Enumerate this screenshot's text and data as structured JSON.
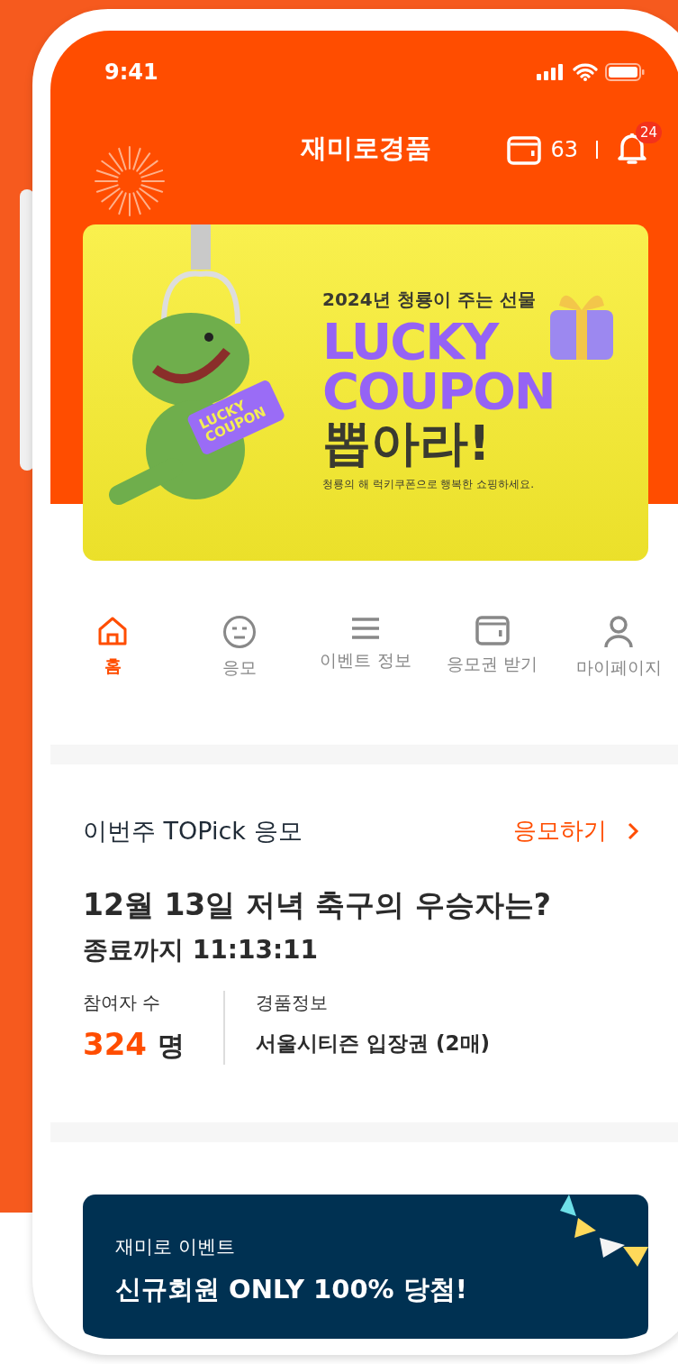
{
  "status_bar": {
    "time": "9:41"
  },
  "header": {
    "title": "재미로경품",
    "wallet_count": "63",
    "notification_badge": "24"
  },
  "banner": {
    "subtitle": "2024년 청룡이 주는 선물",
    "headline": "LUCKY COUPON",
    "title": "뽑아라!",
    "caption": "청룡의 해 럭키쿠폰으로 행복한 쇼핑하세요.",
    "coupon_text": "LUCKY COUPON"
  },
  "nav": [
    {
      "label": "홈",
      "kind": "home",
      "selected": true
    },
    {
      "label": "응모",
      "kind": "face",
      "selected": false
    },
    {
      "label": "이벤트 정보",
      "kind": "list",
      "selected": false
    },
    {
      "label": "응모권 받기",
      "kind": "wallet",
      "selected": false
    },
    {
      "label": "마이페이지",
      "kind": "person",
      "selected": false
    }
  ],
  "topick": {
    "heading": "이번주 TOPick 응모",
    "action": "응모하기",
    "question": "12월 13일 저녁 축구의 우승자는?",
    "countdown": "종료까지 11:13:11",
    "participants_label": "참여자 수",
    "participants_count": "324",
    "participants_unit": "명",
    "prize_label": "경품정보",
    "prize": "서울시티즌 입장권 (2매)"
  },
  "event_banner": {
    "label": "재미로 이벤트",
    "title": "신규회원 ONLY 100% 당첨!"
  }
}
